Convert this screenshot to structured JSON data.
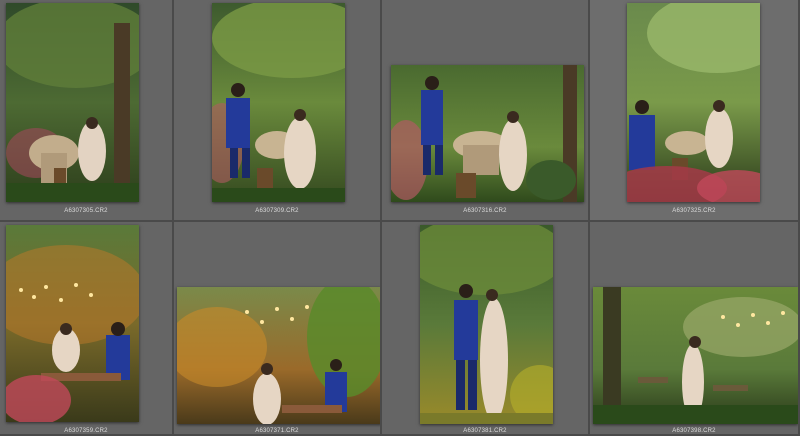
{
  "grid": {
    "cells": [
      {
        "filename": "A6307305.CR2",
        "selected": false
      },
      {
        "filename": "A6307309.CR2",
        "selected": false
      },
      {
        "filename": "A6307316.CR2",
        "selected": false
      },
      {
        "filename": "A6307325.CR2",
        "selected": true
      },
      {
        "filename": "A6307359.CR2",
        "selected": false
      },
      {
        "filename": "A6307371.CR2",
        "selected": false
      },
      {
        "filename": "A6307381.CR2",
        "selected": false
      },
      {
        "filename": "A6307398.CR2",
        "selected": false
      }
    ]
  },
  "colors": {
    "cell_bg": "#656565",
    "cell_selected_bg": "#6d6d6d",
    "grid_line": "#4a4a4a",
    "filename_text": "#dcdcdc"
  }
}
